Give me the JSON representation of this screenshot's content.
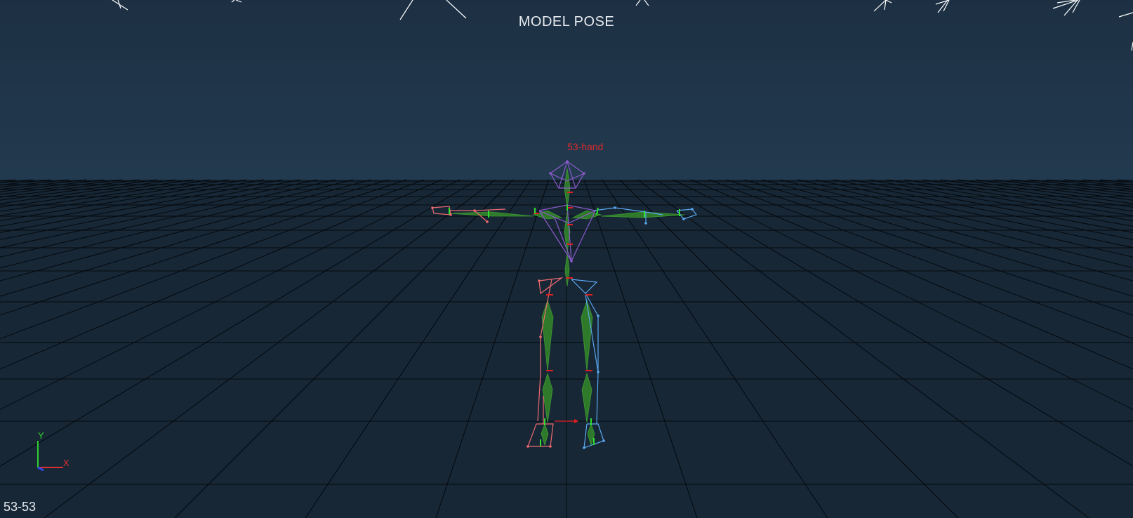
{
  "viewport": {
    "title": "MODEL POSE",
    "model_label": "53-hand",
    "frame_counter": "53-53"
  },
  "axis_gizmo": {
    "y_label": "Y",
    "x_label": "X",
    "colors": {
      "x": "#e23030",
      "y": "#2fd12f",
      "z": "#2f4ae2"
    }
  },
  "colors": {
    "sky": "#1f3246",
    "floor": "#162634",
    "grid_line": "#05090d",
    "bone": "#2f7d2a",
    "left_marker_set": "#f06a70",
    "right_marker_set": "#5aa8ef",
    "center_marker_set": "#8a5ac8",
    "joint_axis_x": "#e02020",
    "joint_axis_y": "#2fe02f",
    "camera_rays": "#ffffff"
  }
}
